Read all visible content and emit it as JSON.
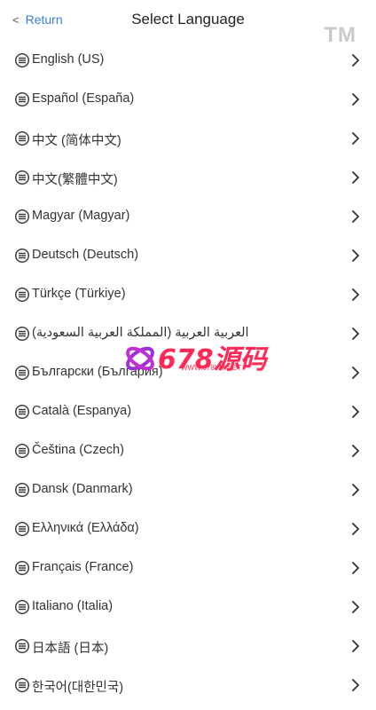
{
  "header": {
    "back_label": "Return",
    "title": "Select Language",
    "tm": "TM"
  },
  "languages": [
    "English (US)",
    "Español (España)",
    "中文 (简体中文)",
    "中文(繁體中文)",
    "Magyar (Magyar)",
    "Deutsch (Deutsch)",
    "Türkçe (Türkiye)",
    "العربية العربية (المملكة العربية السعودية)",
    "Български (България)",
    "Català (Espanya)",
    "Čeština (Czech)",
    "Dansk (Danmark)",
    "Ελληνικά (Ελλάδα)",
    "Français (France)",
    "Italiano (Italia)",
    "日本語 (日本)",
    "한국어(대한민국)"
  ],
  "watermark": {
    "text": "678源码",
    "sub": "WWW.678YM.NET"
  },
  "colors": {
    "accent": "#3b7ddd",
    "watermark": "#ff2a55",
    "text": "#333333"
  }
}
